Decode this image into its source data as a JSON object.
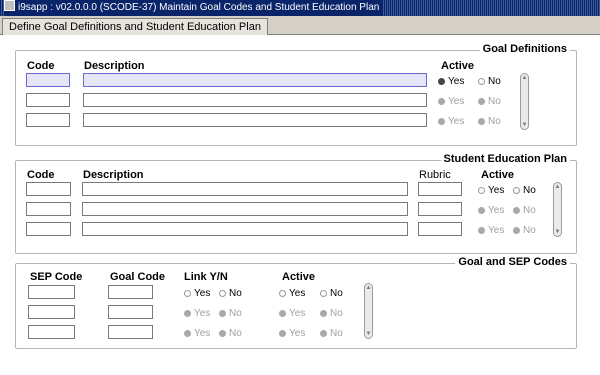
{
  "window": {
    "title": "i9sapp : v02.0.0.0 (SCODE-37) Maintain Goal Codes and Student Education Plan"
  },
  "tab": {
    "label": "Define Goal Definitions and Student Education Plan"
  },
  "goal_definitions": {
    "title": "Goal Definitions",
    "col_code": "Code",
    "col_description": "Description",
    "col_active": "Active",
    "yes": "Yes",
    "no": "No"
  },
  "sep": {
    "title": "Student Education Plan",
    "col_code": "Code",
    "col_description": "Description",
    "col_rubric": "Rubric",
    "col_active": "Active",
    "yes": "Yes",
    "no": "No"
  },
  "goal_sep": {
    "title": "Goal and SEP Codes",
    "col_sep_code": "SEP Code",
    "col_goal_code": "Goal Code",
    "col_link": "Link Y/N",
    "col_active": "Active",
    "yes": "Yes",
    "no": "No"
  }
}
